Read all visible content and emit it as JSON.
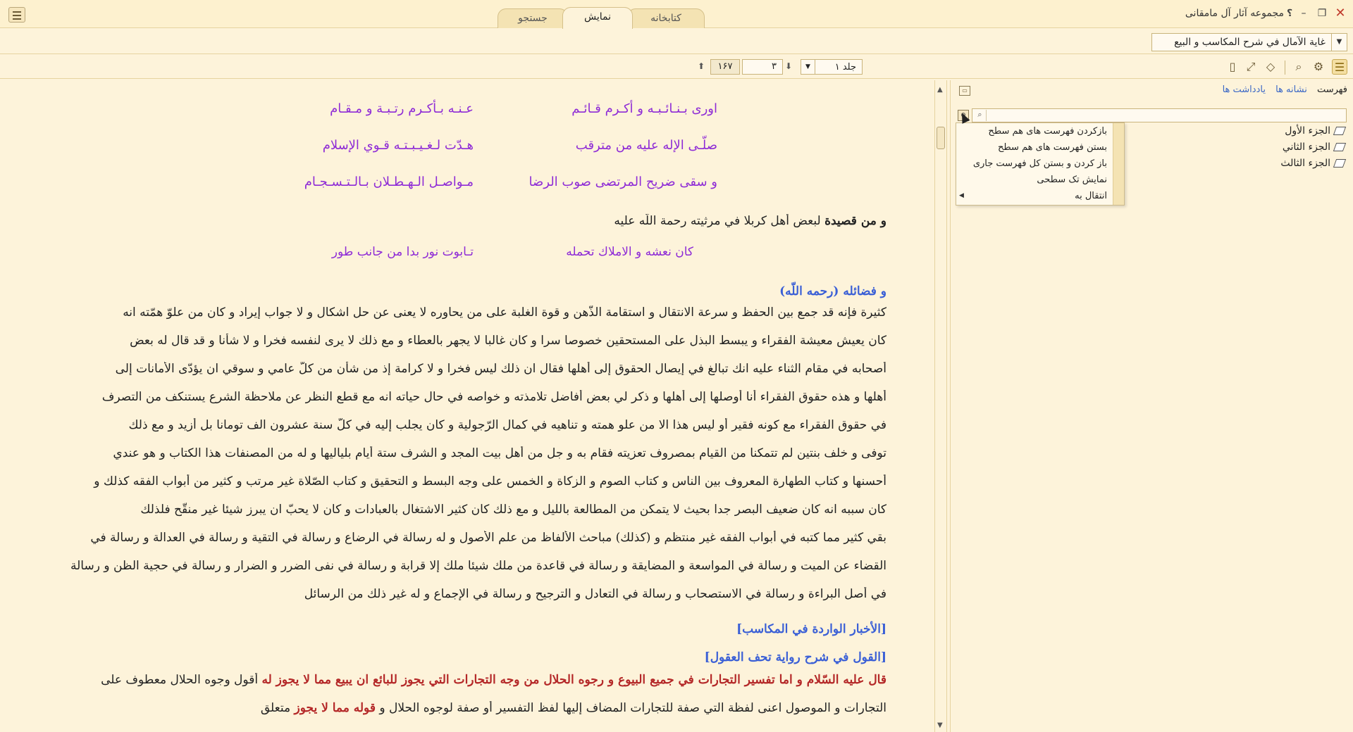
{
  "app": {
    "title": "مجموعه آثار آل مامقانی",
    "help": "؟",
    "min": "–",
    "restore": "❐",
    "close": "✕"
  },
  "tabs": {
    "library": "کتابخانه",
    "display": "نمایش",
    "search": "جستجو"
  },
  "bookbar": {
    "book_title": "غاية الآمال في شرح المكاسب و البيع",
    "dropdown": "▼"
  },
  "toolbar": {
    "volume": "جلد ۱",
    "page": "۳",
    "page_total": "۱۶۷",
    "down_arrow": "⬇",
    "up_arrow": "⬆",
    "dd": "▼"
  },
  "icons": {
    "toc": "☰",
    "gear": "⚙",
    "search": "⌕",
    "eraser": "◇",
    "expand": "⤢",
    "bookmark": "▯"
  },
  "poem1": [
    {
      "h1": "اوری بـنـائـبـه و أكـرم قـائـم",
      "h2": "عـنـه بـأكـرم رتـبـة و مـقـام"
    },
    {
      "h1": "صلّـى الإله عليه من مترقب",
      "h2": "هـدّت لـغـيـبـتـه قـوي الإسلام"
    },
    {
      "h1": "و سقى ضريح المرتضى صوب الرضا",
      "h2": "مـواصـل الـهـطـلان بـالـتـسـجـام"
    }
  ],
  "qasida_intro": {
    "prefix": "و من قصيدة",
    "rest": " لبعض أهل كربلا في مرثيته رحمة اللّه عليه"
  },
  "poem2": {
    "h1": "كان نعشه و الاملاك تحمله",
    "h2": "تـابوت نور بدا من جانب طور"
  },
  "virtues_heading": "و فضائله (رحمه اللّه)",
  "prose_lines": [
    "كثيرة فإنه قد جمع بين الحفظ و سرعة الانتقال و استقامة الذّهن و قوة الغلبة على من يحاوره لا يعنى عن حل اشكال و لا جواب إيراد و كان من علوّ همّته انه",
    "كان يعيش معيشة الفقراء و يبسط البذل على المستحقين خصوصا سرا و كان غالبا لا يجهر بالعطاء و مع ذلك لا يرى لنفسه فخرا و لا شأنا و قد قال له بعض",
    "أصحابه في مقام الثناء عليه انك تبالغ في إيصال الحقوق إلى أهلها فقال ان ذلك ليس فخرا و لا كرامة إذ من شأن من كلّ عامي و سوقي ان يؤدّى الأمانات إلى",
    "أهلها و هذه حقوق الفقراء أنا أوصلها إلى أهلها و ذكر لي بعض أفاضل تلامذته و خواصه في حال حياته انه مع قطع النظر عن ملاحظة الشرع يستنكف من التصرف",
    "في حقوق الفقراء مع كونه فقير أو ليس هذا الا من علو همته و تناهيه في كمال الرّجولية و كان يجلب إليه في كلّ سنة عشرون الف تومانا بل أزيد و مع ذلك",
    "توفى و خلف بنتين لم تتمكنا من القيام بمصروف تعزيته فقام به و جل من أهل بيت المجد و الشرف ستة أيام بلياليها و له من المصنفات هذا الكتاب و هو عندي",
    "أحسنها و كتاب الطهارة المعروف بين الناس و كتاب الصوم و الزكاة و الخمس على وجه البسط و التحقيق و كتاب الصّلاة غير مرتب و كثير من أبواب الفقه كذلك و",
    "كان سببه انه كان ضعيف البصر جدا بحيث لا يتمكن من المطالعة بالليل و مع ذلك كان كثير الاشتغال بالعبادات و كان لا يحبّ ان يبرز شيئا غير منقّح فلذلك",
    "بقي كثير مما كتبه في أبواب الفقه غير منتظم و (كذلك) مباحث الألفاظ من علم الأصول و له رسالة في الرضاع و رسالة في التقية و رسالة في العدالة و رسالة في",
    "القضاء عن الميت و رسالة في المواسعة و المضايقة و رسالة في قاعدة من ملك شيئا ملك إلا قرابة و رسالة في نفى الضرر و الضرار و رسالة في حجية الظن و رسالة",
    "في أصل البراءة و رسالة في الاستصحاب و رسالة في التعادل و الترجيح و رسالة في الإجماع و له غير ذلك من الرسائل"
  ],
  "headings": {
    "akhbar": "[الأخبار الواردة في المكاسب]",
    "qawl": "[القول في شرح رواية تحف العقول]"
  },
  "last_lines": {
    "l1_red": "قال عليه السّلام و اما تفسير التجارات في جميع البيوع و رجوه الحلال من وجه التجارات التي يجوز للبائع ان يبيع مما لا يجوز له",
    "l1_rest": " أقول وجوه الحلال معطوف على",
    "l2_rest": "التجارات و الموصول اعنى لفظة التي صفة للتجارات المضاف إليها لفظ التفسير أو صفة لوجوه الحلال و ",
    "l2_red": "قوله مما لا يجوز",
    "l2_tail": " متعلق"
  },
  "sidebar": {
    "tabs": [
      "فهرست",
      "نشانه ها",
      "يادداشت ها"
    ],
    "toc_items": [
      "الجزء الأول",
      "الجزء الثاني",
      "الجزء الثالث"
    ],
    "search_icon": "⌕"
  },
  "context_menu": {
    "items": [
      "بازكردن فهرست های هم سطح",
      "بستن فهرست های هم سطح",
      "باز كردن و بستن كل فهرست جاری",
      "نمایش تک سطحی",
      "انتقال به"
    ],
    "submenu_arrow": "◀"
  },
  "scrollbar": {
    "up": "▲",
    "down": "▼"
  }
}
